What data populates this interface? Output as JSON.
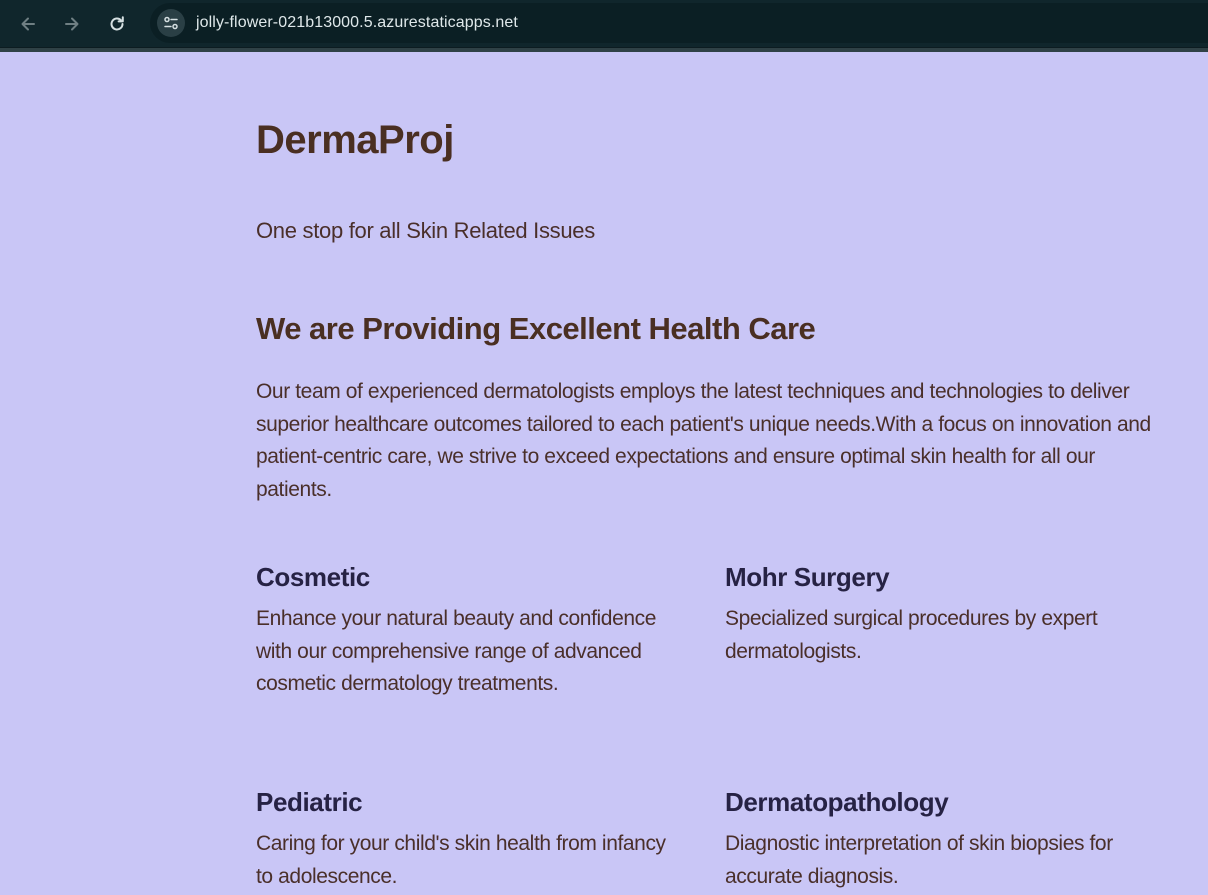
{
  "browser": {
    "url": "jolly-flower-021b13000.5.azurestaticapps.net",
    "icons": {
      "back": "arrow-left-icon",
      "forward": "arrow-right-icon",
      "reload": "reload-icon",
      "site_info": "tune-icon"
    }
  },
  "header": {
    "brand": "DermaProj",
    "tagline": "One stop for all Skin Related Issues"
  },
  "about": {
    "title": "We are Providing Excellent Health Care",
    "body": "Our team of experienced dermatologists employs the latest techniques and technologies to deliver superior healthcare outcomes tailored to each patient's unique needs.With a focus on innovation and patient-centric care, we strive to exceed expectations and ensure optimal skin health for all our patients."
  },
  "services": [
    {
      "title": "Cosmetic",
      "description": "Enhance your natural beauty and confidence with our comprehensive range of advanced cosmetic dermatology treatments."
    },
    {
      "title": "Mohr Surgery",
      "description": "Specialized surgical procedures by expert dermatologists."
    },
    {
      "title": "Pediatric",
      "description": "Caring for your child's skin health from infancy to adolescence."
    },
    {
      "title": "Dermatopathology",
      "description": "Diagnostic interpretation of skin biopsies for accurate diagnosis."
    }
  ],
  "colors": {
    "page_background": "#c9c6f6",
    "heading_brown": "#4a2f22",
    "service_title_navy": "#262244",
    "browser_toolbar": "#10262c"
  }
}
